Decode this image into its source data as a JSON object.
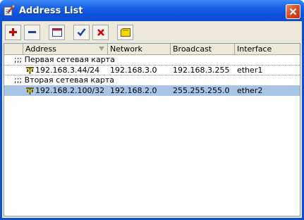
{
  "window": {
    "title": "Address List",
    "app_icon": "notepad-pencil-icon",
    "close_icon": "close-icon"
  },
  "toolbar": {
    "buttons": [
      {
        "icon": "plus-icon",
        "color": "#d40000"
      },
      {
        "icon": "minus-icon",
        "color": "#1e3fb0"
      },
      {
        "icon": "window-icon",
        "color": "#c02020"
      },
      {
        "icon": "checkmark-icon",
        "color": "#1e3fb0"
      },
      {
        "icon": "x-icon",
        "color": "#d40000"
      },
      {
        "icon": "comment-note-icon",
        "color": "#f0d000"
      }
    ]
  },
  "table": {
    "columns": [
      "Address",
      "Network",
      "Broadcast",
      "Interface"
    ],
    "sorted_column": "Address",
    "groups": [
      {
        "comment_prefix": ";;;",
        "comment": "Первая сетевая карта",
        "row": {
          "address": "192.168.3.44/24",
          "network": "192.168.3.0",
          "broadcast": "192.168.3.255",
          "interface": "ether1",
          "selected": false
        }
      },
      {
        "comment_prefix": ";;;",
        "comment": "Вторая сетевая карта",
        "row": {
          "address": "192.168.2.100/32",
          "network": "192.168.2.0",
          "broadcast": "255.255.255.0",
          "interface": "ether2",
          "selected": true
        }
      }
    ]
  },
  "colors": {
    "title_bar": "#0a50d8",
    "selection": "#a8c4e6",
    "client_bg": "#ece9d8"
  }
}
